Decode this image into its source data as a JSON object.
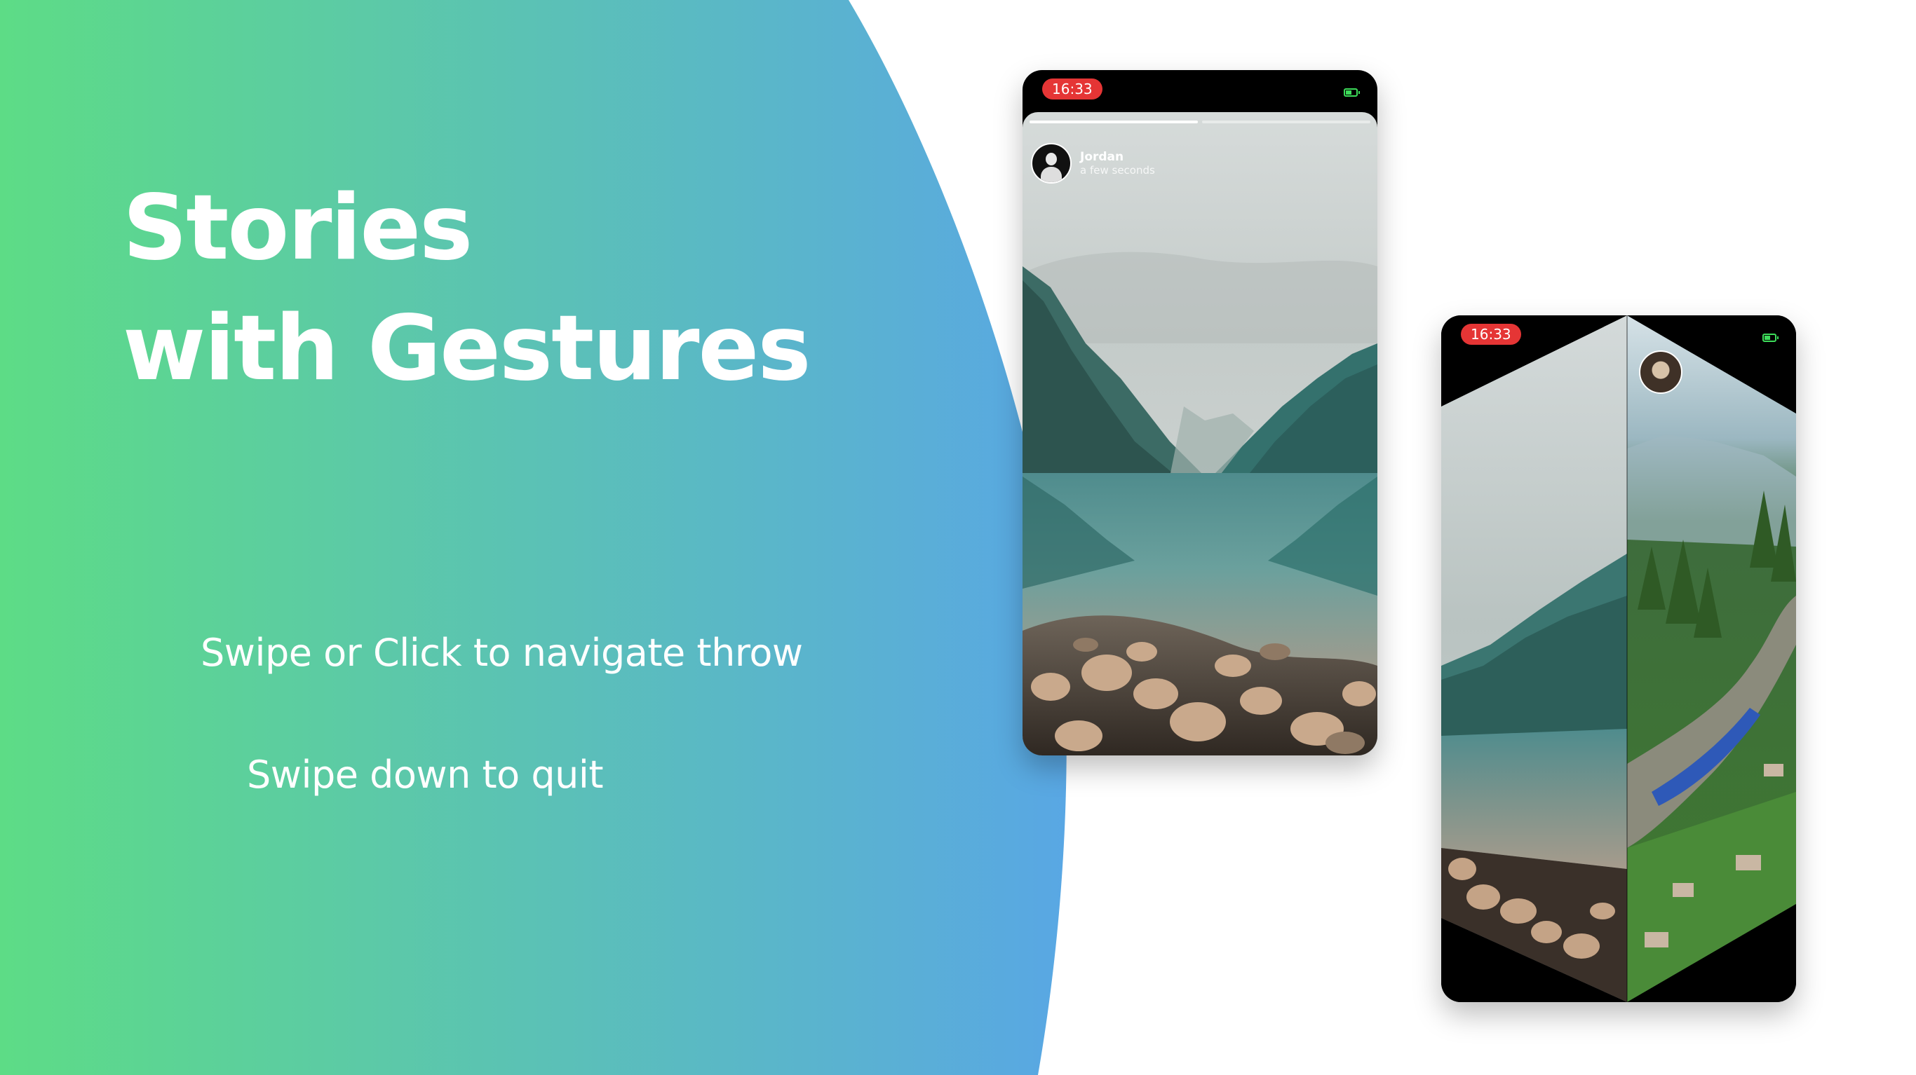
{
  "hero": {
    "title_line1": "Stories",
    "title_line2": "with Gestures",
    "hint_navigate": "Swipe or Click to navigate throw",
    "hint_quit": "Swipe down to quit",
    "gradient_start": "#5ddc86",
    "gradient_end": "#59a7e4"
  },
  "phone_main": {
    "time": "16:33",
    "story": {
      "username": "Jordan",
      "timestamp": "a few seconds",
      "progress": [
        1.0,
        0.0
      ]
    }
  },
  "phone_transition": {
    "time": "16:33"
  },
  "colors": {
    "time_pill": "#e53535",
    "battery": "#3ddc5a"
  },
  "icons": [
    "battery-icon",
    "avatar"
  ]
}
